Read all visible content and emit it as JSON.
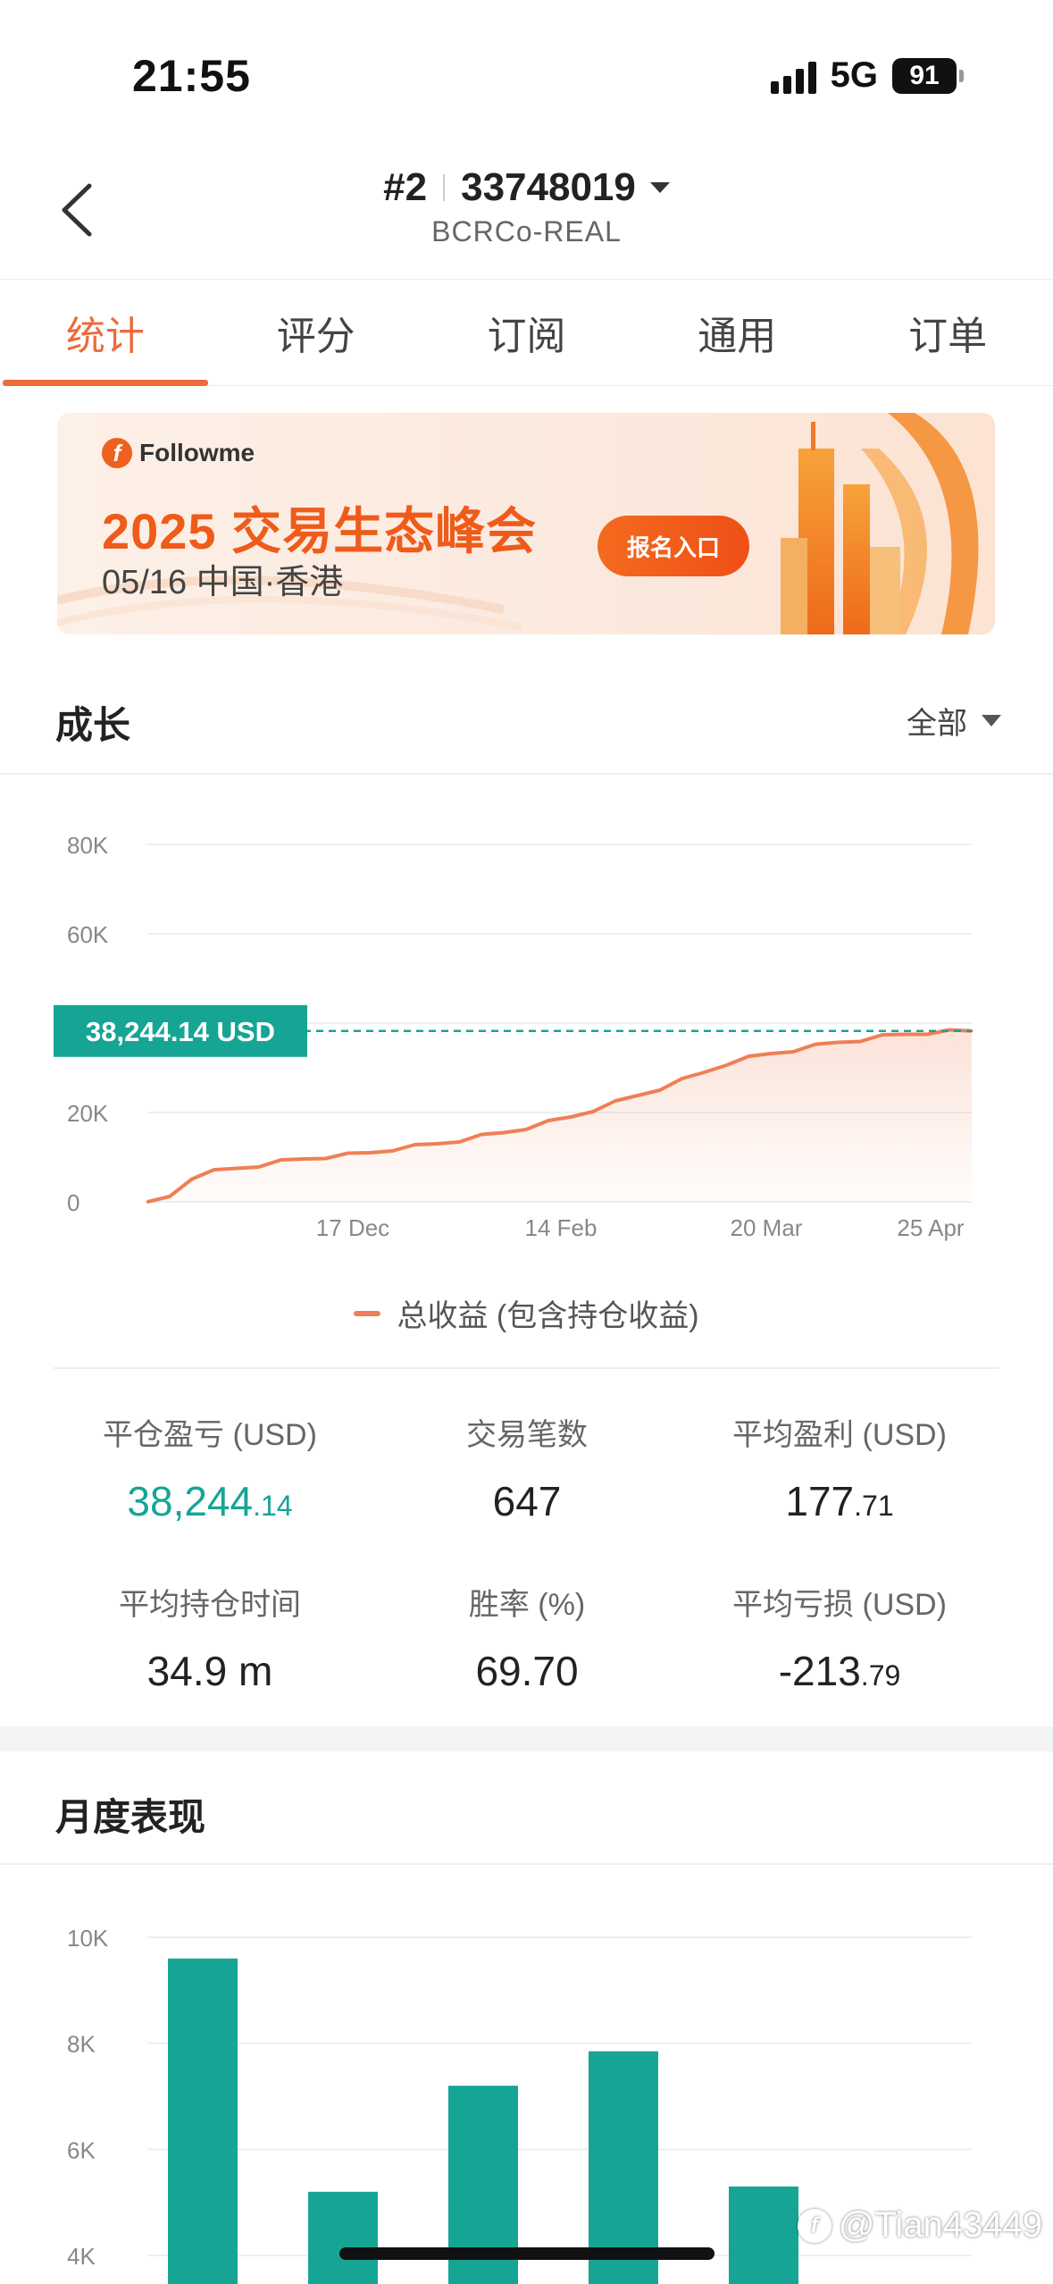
{
  "status_bar": {
    "time": "21:55",
    "network": "5G",
    "battery": "91"
  },
  "header": {
    "rank": "#2",
    "account_number": "33748019",
    "server": "BCRCo-REAL"
  },
  "tabs": [
    {
      "label": "统计",
      "active": true
    },
    {
      "label": "评分",
      "active": false
    },
    {
      "label": "订阅",
      "active": false
    },
    {
      "label": "通用",
      "active": false
    },
    {
      "label": "订单",
      "active": false
    }
  ],
  "banner": {
    "logo_text": "Followme",
    "title": "2025 交易生态峰会",
    "subtitle": "05/16 中国·香港",
    "button_label": "报名入口"
  },
  "growth": {
    "title": "成长",
    "range_label": "全部",
    "current_value_label": "38,244.14 USD",
    "legend_label": "总收益 (包含持仓收益)"
  },
  "chart_data": [
    {
      "type": "area",
      "title": "",
      "xlabel": "",
      "ylabel": "",
      "y_ticks": [
        "80K",
        "60K",
        "20K",
        "0"
      ],
      "x_ticks": [
        "17 Dec",
        "14 Feb",
        "20 Mar",
        "25 Apr"
      ],
      "ylim": [
        0,
        80000
      ],
      "series": [
        {
          "name": "总收益 (包含持仓收益)",
          "color": "#ef7f55",
          "values": [
            0,
            1200,
            5500,
            6800,
            7500,
            8200,
            9000,
            9600,
            10100,
            10500,
            11000,
            11800,
            12400,
            13000,
            13800,
            14700,
            15500,
            16600,
            17800,
            19000,
            20600,
            22200,
            23800,
            25400,
            27200,
            29000,
            31000,
            32200,
            33200,
            34000,
            34900,
            35700,
            36300,
            37000,
            37500,
            37900,
            38100,
            38244.14
          ]
        }
      ],
      "reference_line": {
        "value": 38244.14,
        "label": "38,244.14 USD",
        "color": "#16a595"
      },
      "grid": true,
      "legend_placement": "bottom"
    },
    {
      "type": "bar",
      "title": "月度表现",
      "y_ticks": [
        "10K",
        "8K",
        "6K",
        "4K"
      ],
      "ylim": [
        4000,
        10000
      ],
      "values": [
        9600,
        5200,
        7200,
        7850,
        5300
      ],
      "color": "#16a595",
      "grid": true
    }
  ],
  "stats": {
    "closed_pnl": {
      "label": "平仓盈亏 (USD)",
      "int": "38,244",
      "dec": ".14"
    },
    "trades": {
      "label": "交易笔数",
      "value": "647"
    },
    "avg_profit": {
      "label": "平均盈利 (USD)",
      "int": "177",
      "dec": ".71"
    },
    "avg_hold": {
      "label": "平均持仓时间",
      "value": "34.9 m"
    },
    "win_rate": {
      "label": "胜率 (%)",
      "value": "69.70"
    },
    "avg_loss": {
      "label": "平均亏损 (USD)",
      "int": "-213",
      "dec": ".79"
    }
  },
  "monthly": {
    "title": "月度表现"
  },
  "watermark": "@Tian43449",
  "colors": {
    "accent": "#ee6a3c",
    "green": "#16a595",
    "line": "#ef7f55"
  }
}
